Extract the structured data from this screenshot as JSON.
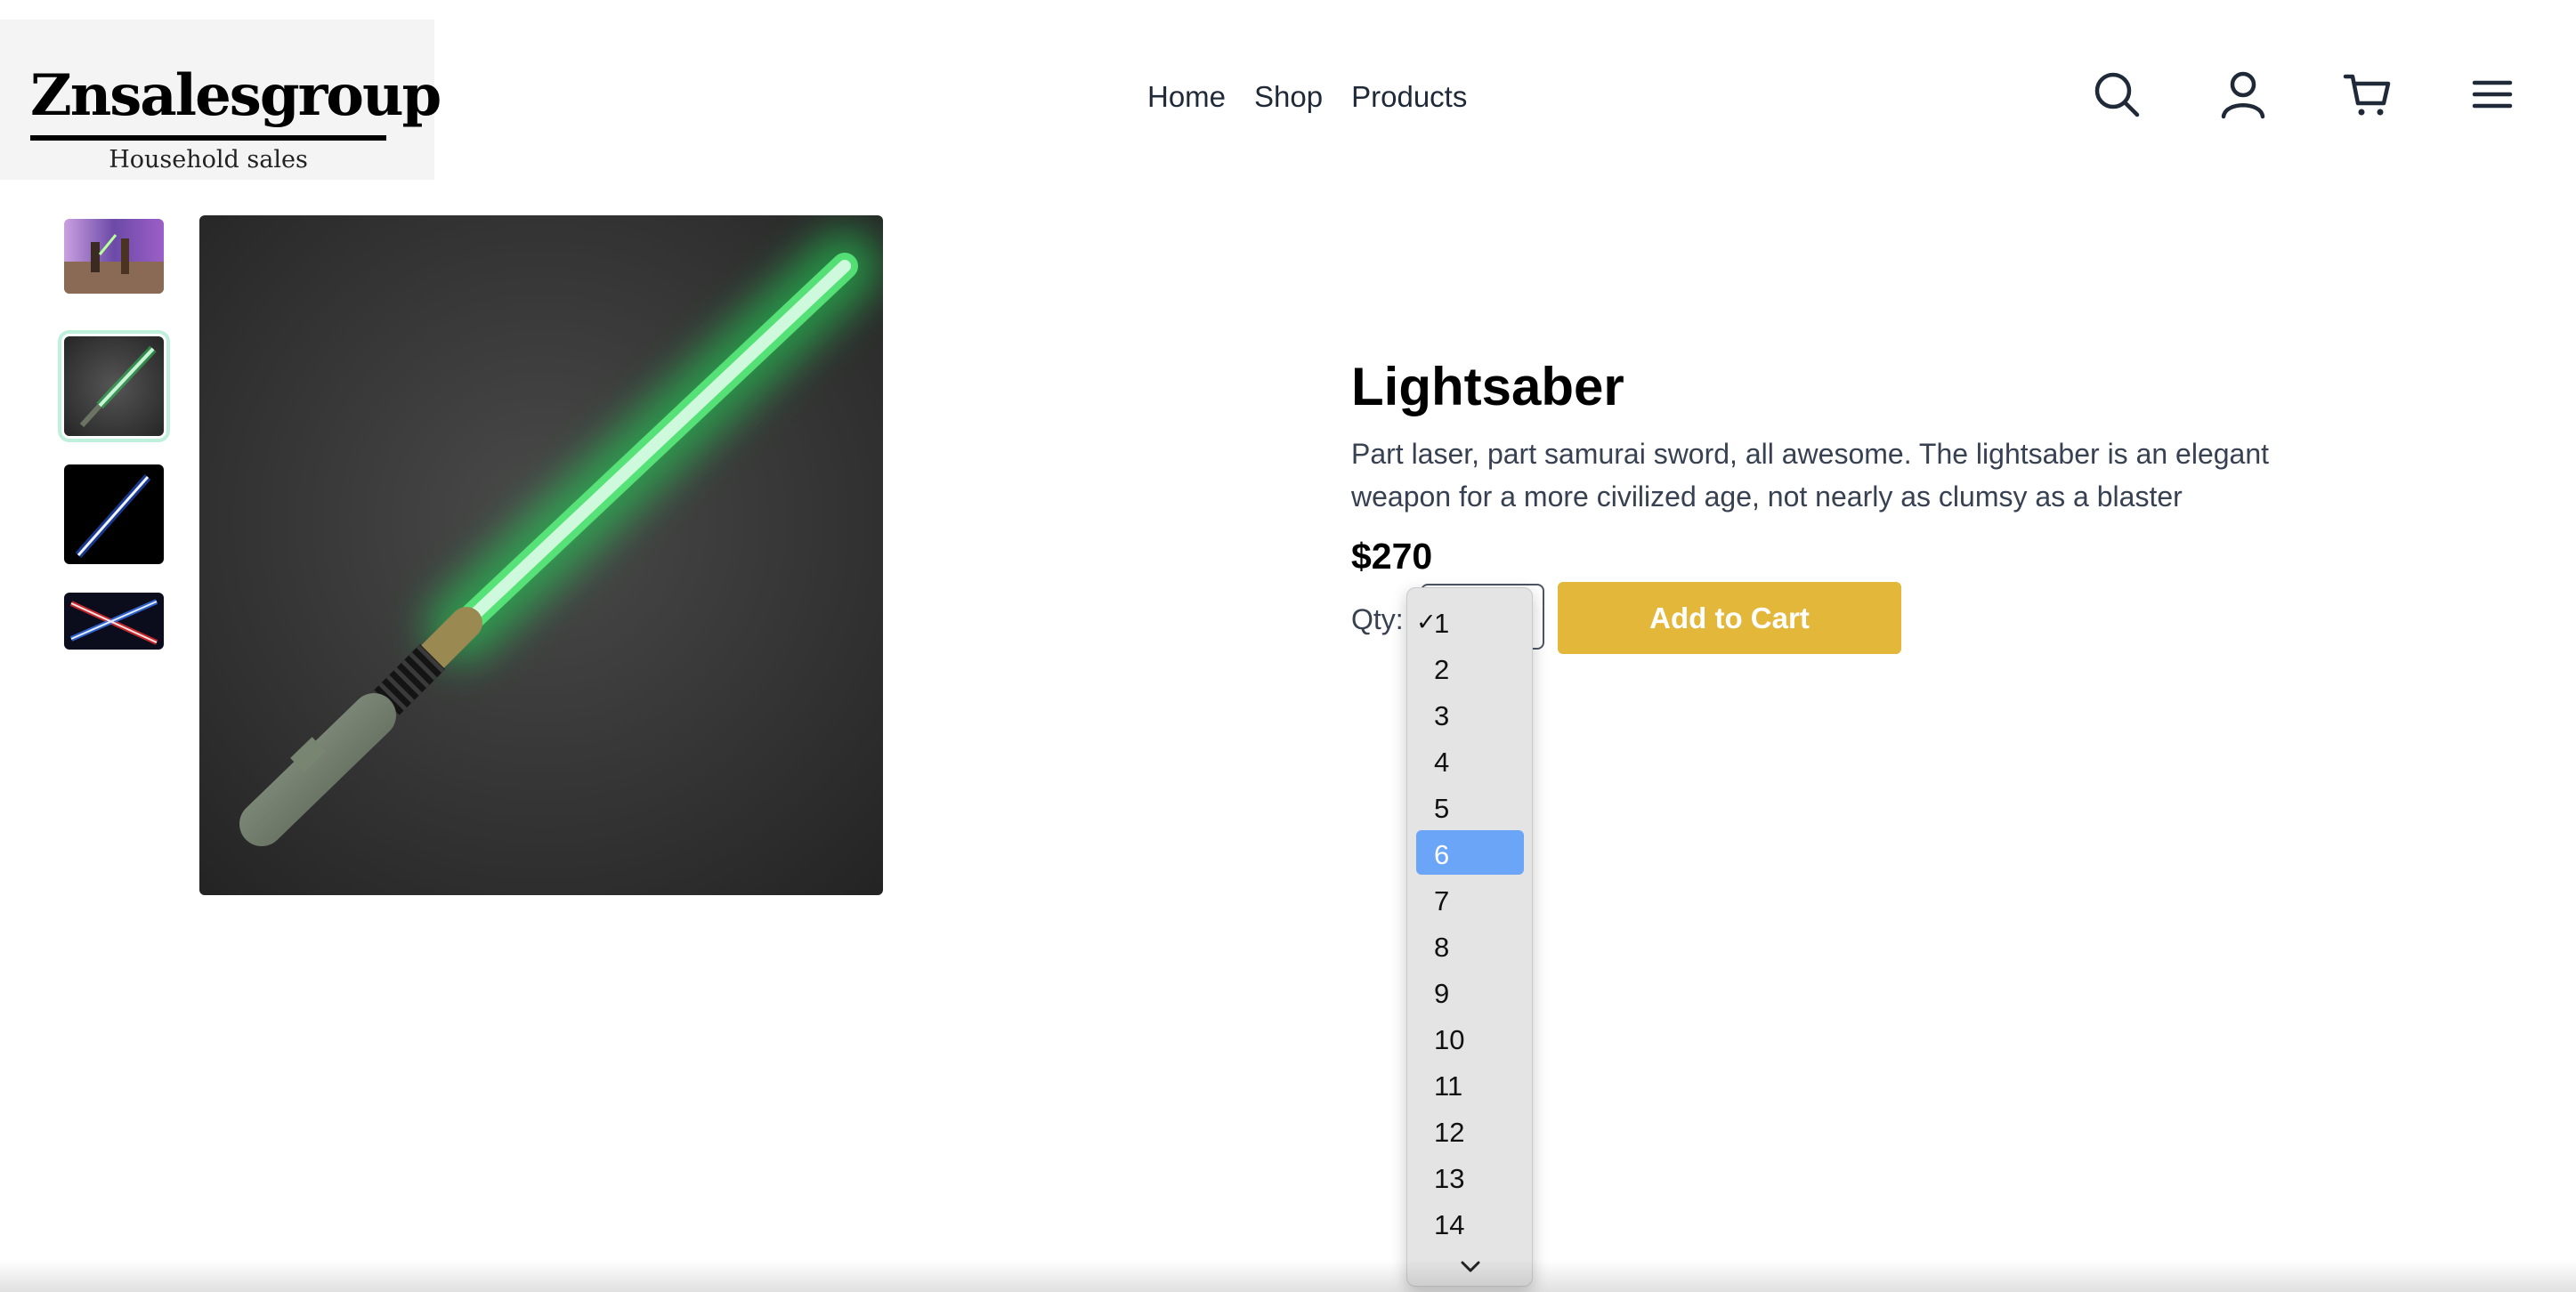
{
  "header": {
    "logo_name": "Znsalesgroup",
    "logo_tagline": "Household sales",
    "nav": [
      "Home",
      "Shop",
      "Products"
    ],
    "icons": [
      "search-icon",
      "user-icon",
      "cart-icon",
      "menu-icon"
    ]
  },
  "product": {
    "title": "Lightsaber",
    "description": "Part laser, part samurai sword, all awesome. The lightsaber is an elegant weapon for a more civilized age, not nearly as clumsy as a blaster",
    "price": "$270",
    "qty_label": "Qty:",
    "add_to_cart": "Add to Cart"
  },
  "quantity_dropdown": {
    "options": [
      "1",
      "2",
      "3",
      "4",
      "5",
      "6",
      "7",
      "8",
      "9",
      "10",
      "11",
      "12",
      "13",
      "14"
    ],
    "checked": "1",
    "highlighted": "6",
    "check_mark": "✓"
  },
  "colors": {
    "accent_button": "#e3b73a",
    "highlight_option": "#6aa5f7",
    "selected_thumb_outline": "#bff0dc"
  }
}
